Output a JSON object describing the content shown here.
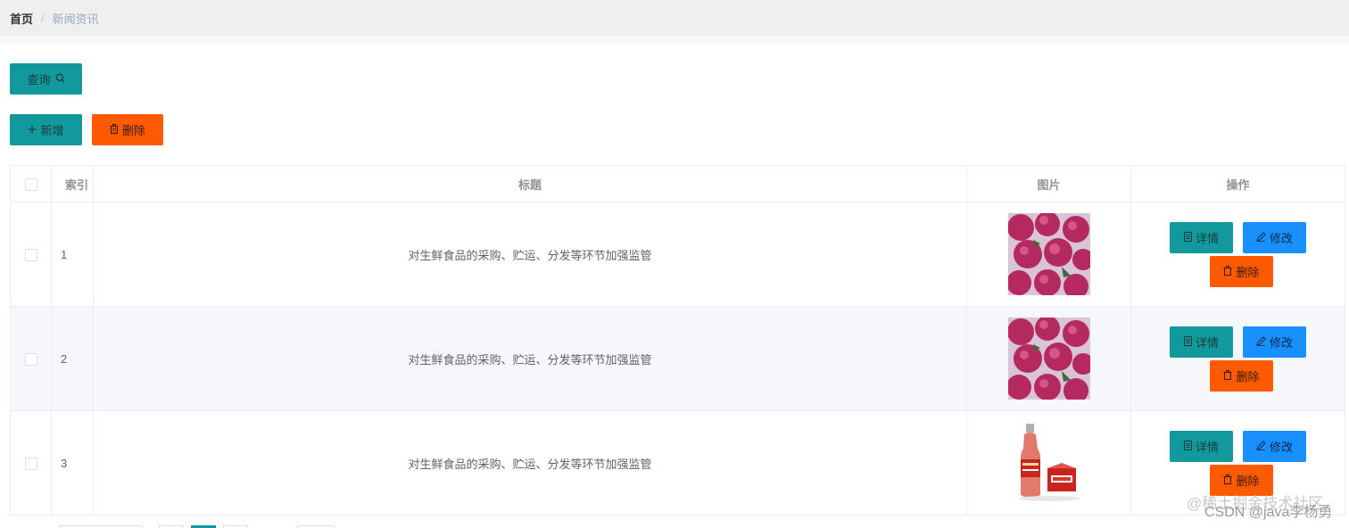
{
  "breadcrumb": {
    "home": "首页",
    "separator": "/",
    "current": "新闻资讯"
  },
  "toolbar": {
    "query_label": "查询",
    "add_label": "新增",
    "batch_delete_label": "删除"
  },
  "table": {
    "headers": {
      "index": "索引",
      "title": "标题",
      "image": "图片",
      "actions": "操作"
    },
    "rows": [
      {
        "index": "1",
        "title": "对生鲜食品的采购、贮运、分发等环节加强监管",
        "image": "bayberry-photo",
        "detail": "详情",
        "edit": "修改",
        "delete": "删除"
      },
      {
        "index": "2",
        "title": "对生鲜食品的采购、贮运、分发等环节加强监管",
        "image": "bayberry-photo",
        "detail": "详情",
        "edit": "修改",
        "delete": "删除"
      },
      {
        "index": "3",
        "title": "对生鲜食品的采购、贮运、分发等环节加强监管",
        "image": "juice-bottle-photo",
        "detail": "详情",
        "edit": "修改",
        "delete": "删除"
      }
    ]
  },
  "watermark": {
    "line1": "@稀土掘金技术社区",
    "line2": "CSDN @java李杨勇"
  },
  "colors": {
    "teal": "#11999e",
    "orange": "#ff5a00",
    "blue": "#1890ff",
    "stripe": "#f5f7fa"
  }
}
